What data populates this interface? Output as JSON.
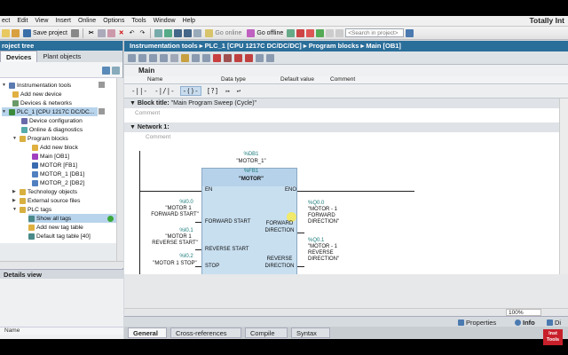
{
  "colors": {
    "accent": "#2a6e9a",
    "selected": "#b8d4ec",
    "fb_box": "#c8dff0",
    "logo": "#c8202a"
  },
  "menu": [
    "ect",
    "Edit",
    "View",
    "Insert",
    "Online",
    "Options",
    "Tools",
    "Window",
    "Help"
  ],
  "brand": "Totally Int",
  "toolbar": {
    "save_label": "Save project",
    "go_online": "Go online",
    "go_offline": "Go offline",
    "search_placeholder": "<Search in project>"
  },
  "project_tree": {
    "title": "roject tree",
    "tabs": [
      "Devices",
      "Plant objects"
    ],
    "items": [
      {
        "label": "Instrumentation tools",
        "icon": "project-icon"
      },
      {
        "label": "Add new device",
        "icon": "add-device-icon"
      },
      {
        "label": "Devices & networks",
        "icon": "network-icon"
      },
      {
        "label": "PLC_1 [CPU 1217C DC/DC...",
        "icon": "plc-icon"
      },
      {
        "label": "Device configuration",
        "icon": "config-icon"
      },
      {
        "label": "Online & diagnostics",
        "icon": "diagnostics-icon"
      },
      {
        "label": "Program blocks",
        "icon": "folder-icon"
      },
      {
        "label": "Add new block",
        "icon": "add-block-icon"
      },
      {
        "label": "Main [OB1]",
        "icon": "ob-icon"
      },
      {
        "label": "MOTOR [FB1]",
        "icon": "fb-icon"
      },
      {
        "label": "MOTOR_1 [DB1]",
        "icon": "db-icon"
      },
      {
        "label": "MOTOR_2 [DB2]",
        "icon": "db-icon"
      },
      {
        "label": "Technology objects",
        "icon": "folder-icon"
      },
      {
        "label": "External source files",
        "icon": "folder-icon"
      },
      {
        "label": "PLC tags",
        "icon": "folder-icon"
      },
      {
        "label": "Show all tags",
        "icon": "tags-icon"
      },
      {
        "label": "Add new tag table",
        "icon": "add-table-icon"
      },
      {
        "label": "Default tag table [40]",
        "icon": "table-icon"
      }
    ]
  },
  "details": {
    "title": "Details view",
    "col_name": "Name"
  },
  "breadcrumb": "Instrumentation tools  ▸  PLC_1 [CPU 1217C DC/DC/DC]  ▸  Program blocks  ▸  Main [OB1]",
  "interface": {
    "title": "Main",
    "columns": [
      "Name",
      "Data type",
      "Default value",
      "Comment"
    ]
  },
  "editor": {
    "block_title_label": "Block title:",
    "block_title_value": "\"Main Program Sweep (Cycle)\"",
    "comment": "Comment",
    "network_label": "Network 1:",
    "network_comment": "Comment"
  },
  "fb": {
    "db_addr": "%DB1",
    "db_name": "\"MOTOR_1\"",
    "fb_addr": "%FB1",
    "fb_name": "\"MOTOR\"",
    "en": "EN",
    "eno": "ENO",
    "inputs": [
      {
        "addr": "%I0.0",
        "tag1": "\"MOTOR 1",
        "tag2": "FORWARD START\"",
        "pin": "FORWARD START"
      },
      {
        "addr": "%I0.1",
        "tag1": "\"MOTOR 1",
        "tag2": "REVERSE START\"",
        "pin": "REVERSE START"
      },
      {
        "addr": "%I0.2",
        "tag1": "\"MOTOR 1 STOP\"",
        "tag2": "",
        "pin": "STOP"
      }
    ],
    "outputs": [
      {
        "pin1": "FORWARD",
        "pin2": "DIRECTION",
        "addr": "%Q0.0",
        "tag1": "\"MOTOR - 1",
        "tag2": "FORWARD",
        "tag3": "DIRECTION\""
      },
      {
        "pin1": "REVERSE",
        "pin2": "DIRECTION",
        "addr": "%Q0.1",
        "tag1": "\"MOTOR - 1",
        "tag2": "REVERSE",
        "tag3": "DIRECTION\""
      }
    ]
  },
  "zoom": "100%",
  "properties_tabs": [
    "Properties",
    "Info",
    "Di"
  ],
  "bottom_tabs": [
    "General",
    "Cross-references",
    "Compile",
    "Syntax"
  ],
  "logo": {
    "line1": "Inst",
    "line2": "Tools"
  }
}
